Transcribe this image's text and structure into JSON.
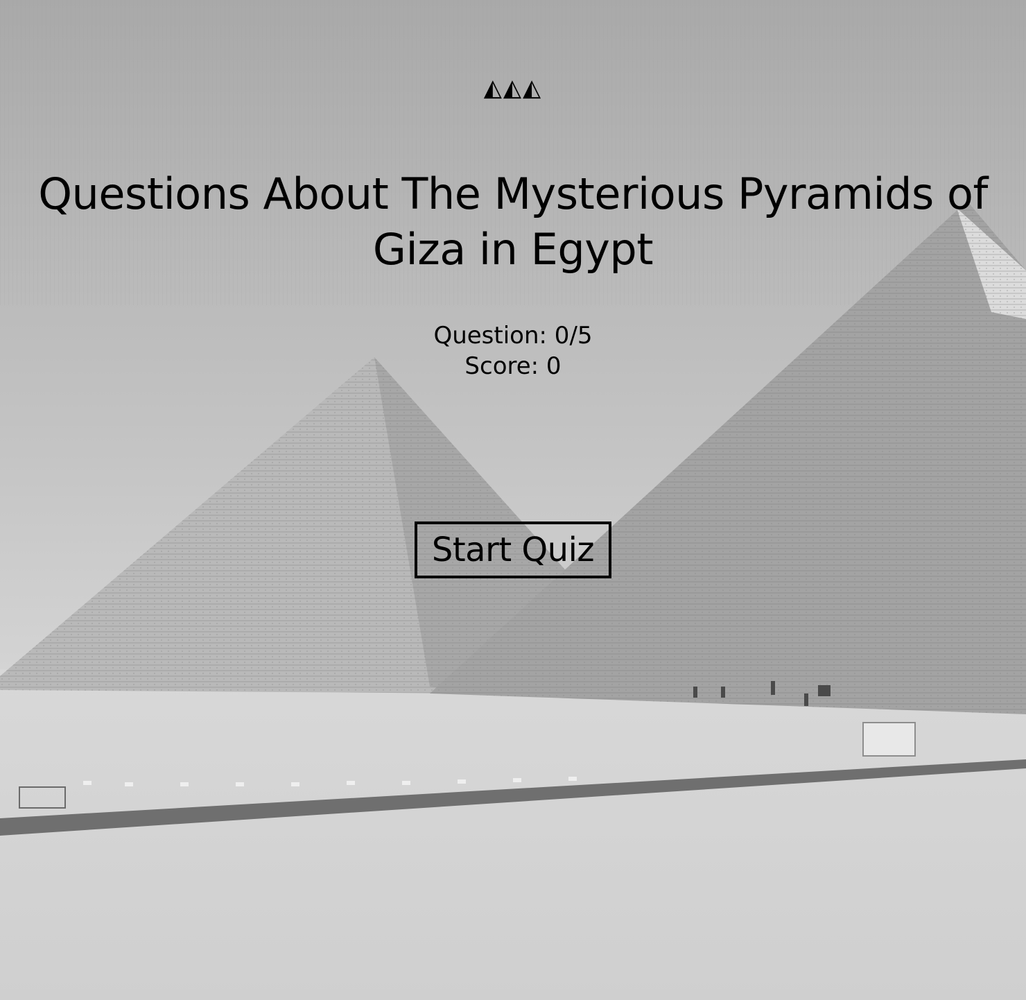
{
  "header": {
    "logo": "◭◭◭"
  },
  "quiz": {
    "title": "Questions About The Mysterious Pyramids of Giza in Egypt",
    "question_label": "Question: ",
    "question_current": "0",
    "question_total": "5",
    "score_label": "Score: ",
    "score_value": "0",
    "start_button_label": "Start Quiz"
  },
  "background": {
    "description_icon": "pyramids-photo",
    "tone": "#b5b5b5"
  }
}
